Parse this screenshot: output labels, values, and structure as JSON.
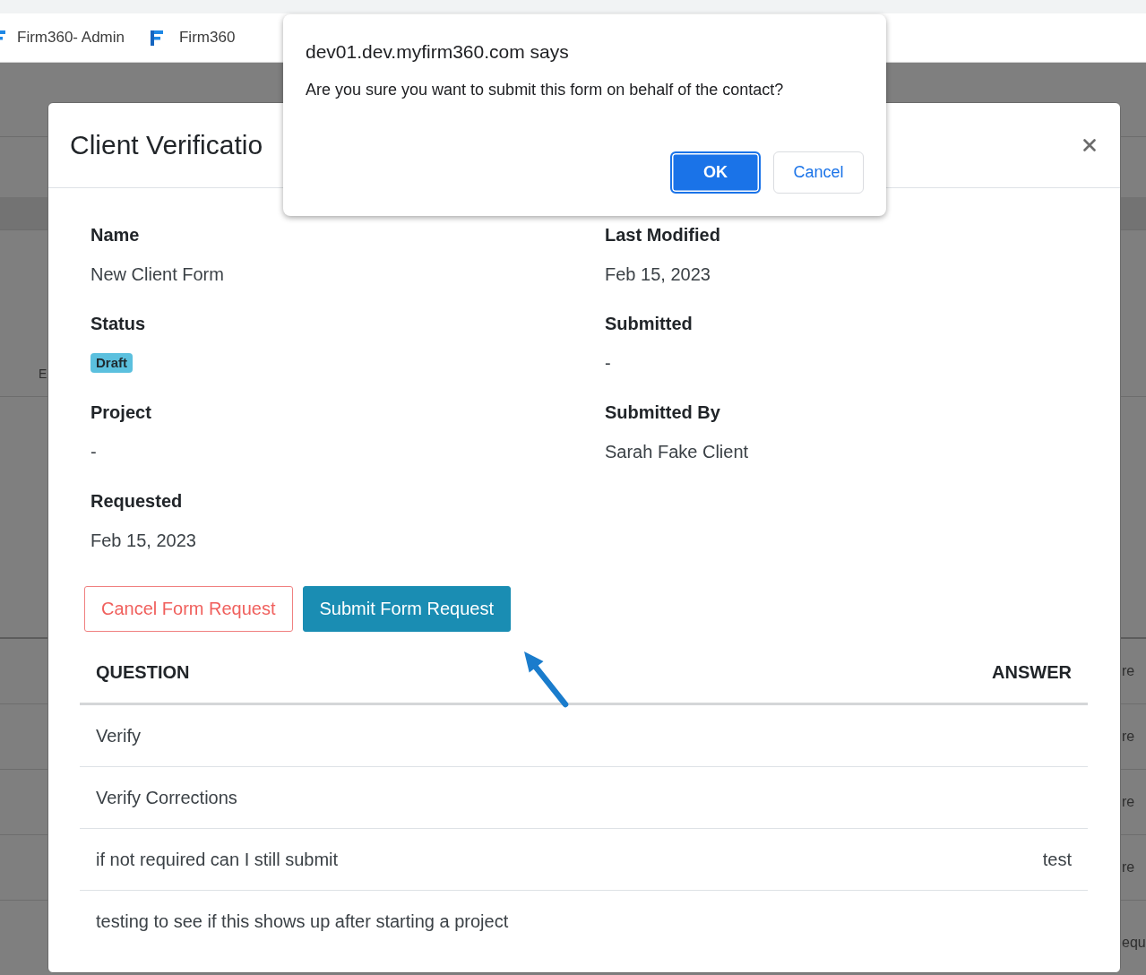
{
  "browser": {
    "bookmarks": [
      {
        "label": "Firm360- Admin"
      },
      {
        "label": "Firm360"
      }
    ]
  },
  "background": {
    "side_text": "E",
    "row_texts": [
      "re",
      "re",
      "re",
      "re",
      "equ"
    ]
  },
  "modal": {
    "title": "Client Verificatio",
    "fields": [
      {
        "label": "Name",
        "value": "New Client Form",
        "kind": "text"
      },
      {
        "label": "Last Modified",
        "value": "Feb 15, 2023",
        "kind": "text"
      },
      {
        "label": "Status",
        "value": "Draft",
        "kind": "badge"
      },
      {
        "label": "Submitted",
        "value": "-",
        "kind": "text"
      },
      {
        "label": "Project",
        "value": "-",
        "kind": "text"
      },
      {
        "label": "Submitted By",
        "value": "Sarah Fake Client",
        "kind": "text"
      },
      {
        "label": "Requested",
        "value": "Feb 15, 2023",
        "kind": "text"
      }
    ],
    "buttons": [
      {
        "label": "Cancel Form Request",
        "kind": "outline-danger"
      },
      {
        "label": "Submit Form Request",
        "kind": "primary"
      }
    ],
    "table": {
      "columns": [
        "QUESTION",
        "ANSWER"
      ],
      "rows": [
        {
          "question": "Verify"
        },
        {
          "question": "Verify Corrections"
        },
        {
          "question": "if not required can I still submit",
          "answer": "test"
        },
        {
          "question": "testing to see if this shows up after starting a project"
        }
      ]
    }
  },
  "alert": {
    "title": "dev01.dev.myfirm360.com says",
    "message": "Are you sure you want to submit this form on behalf of the contact?",
    "buttons": [
      {
        "label": "OK",
        "kind": "primary",
        "focused": true
      },
      {
        "label": "Cancel",
        "kind": "default",
        "focused": false
      }
    ]
  }
}
